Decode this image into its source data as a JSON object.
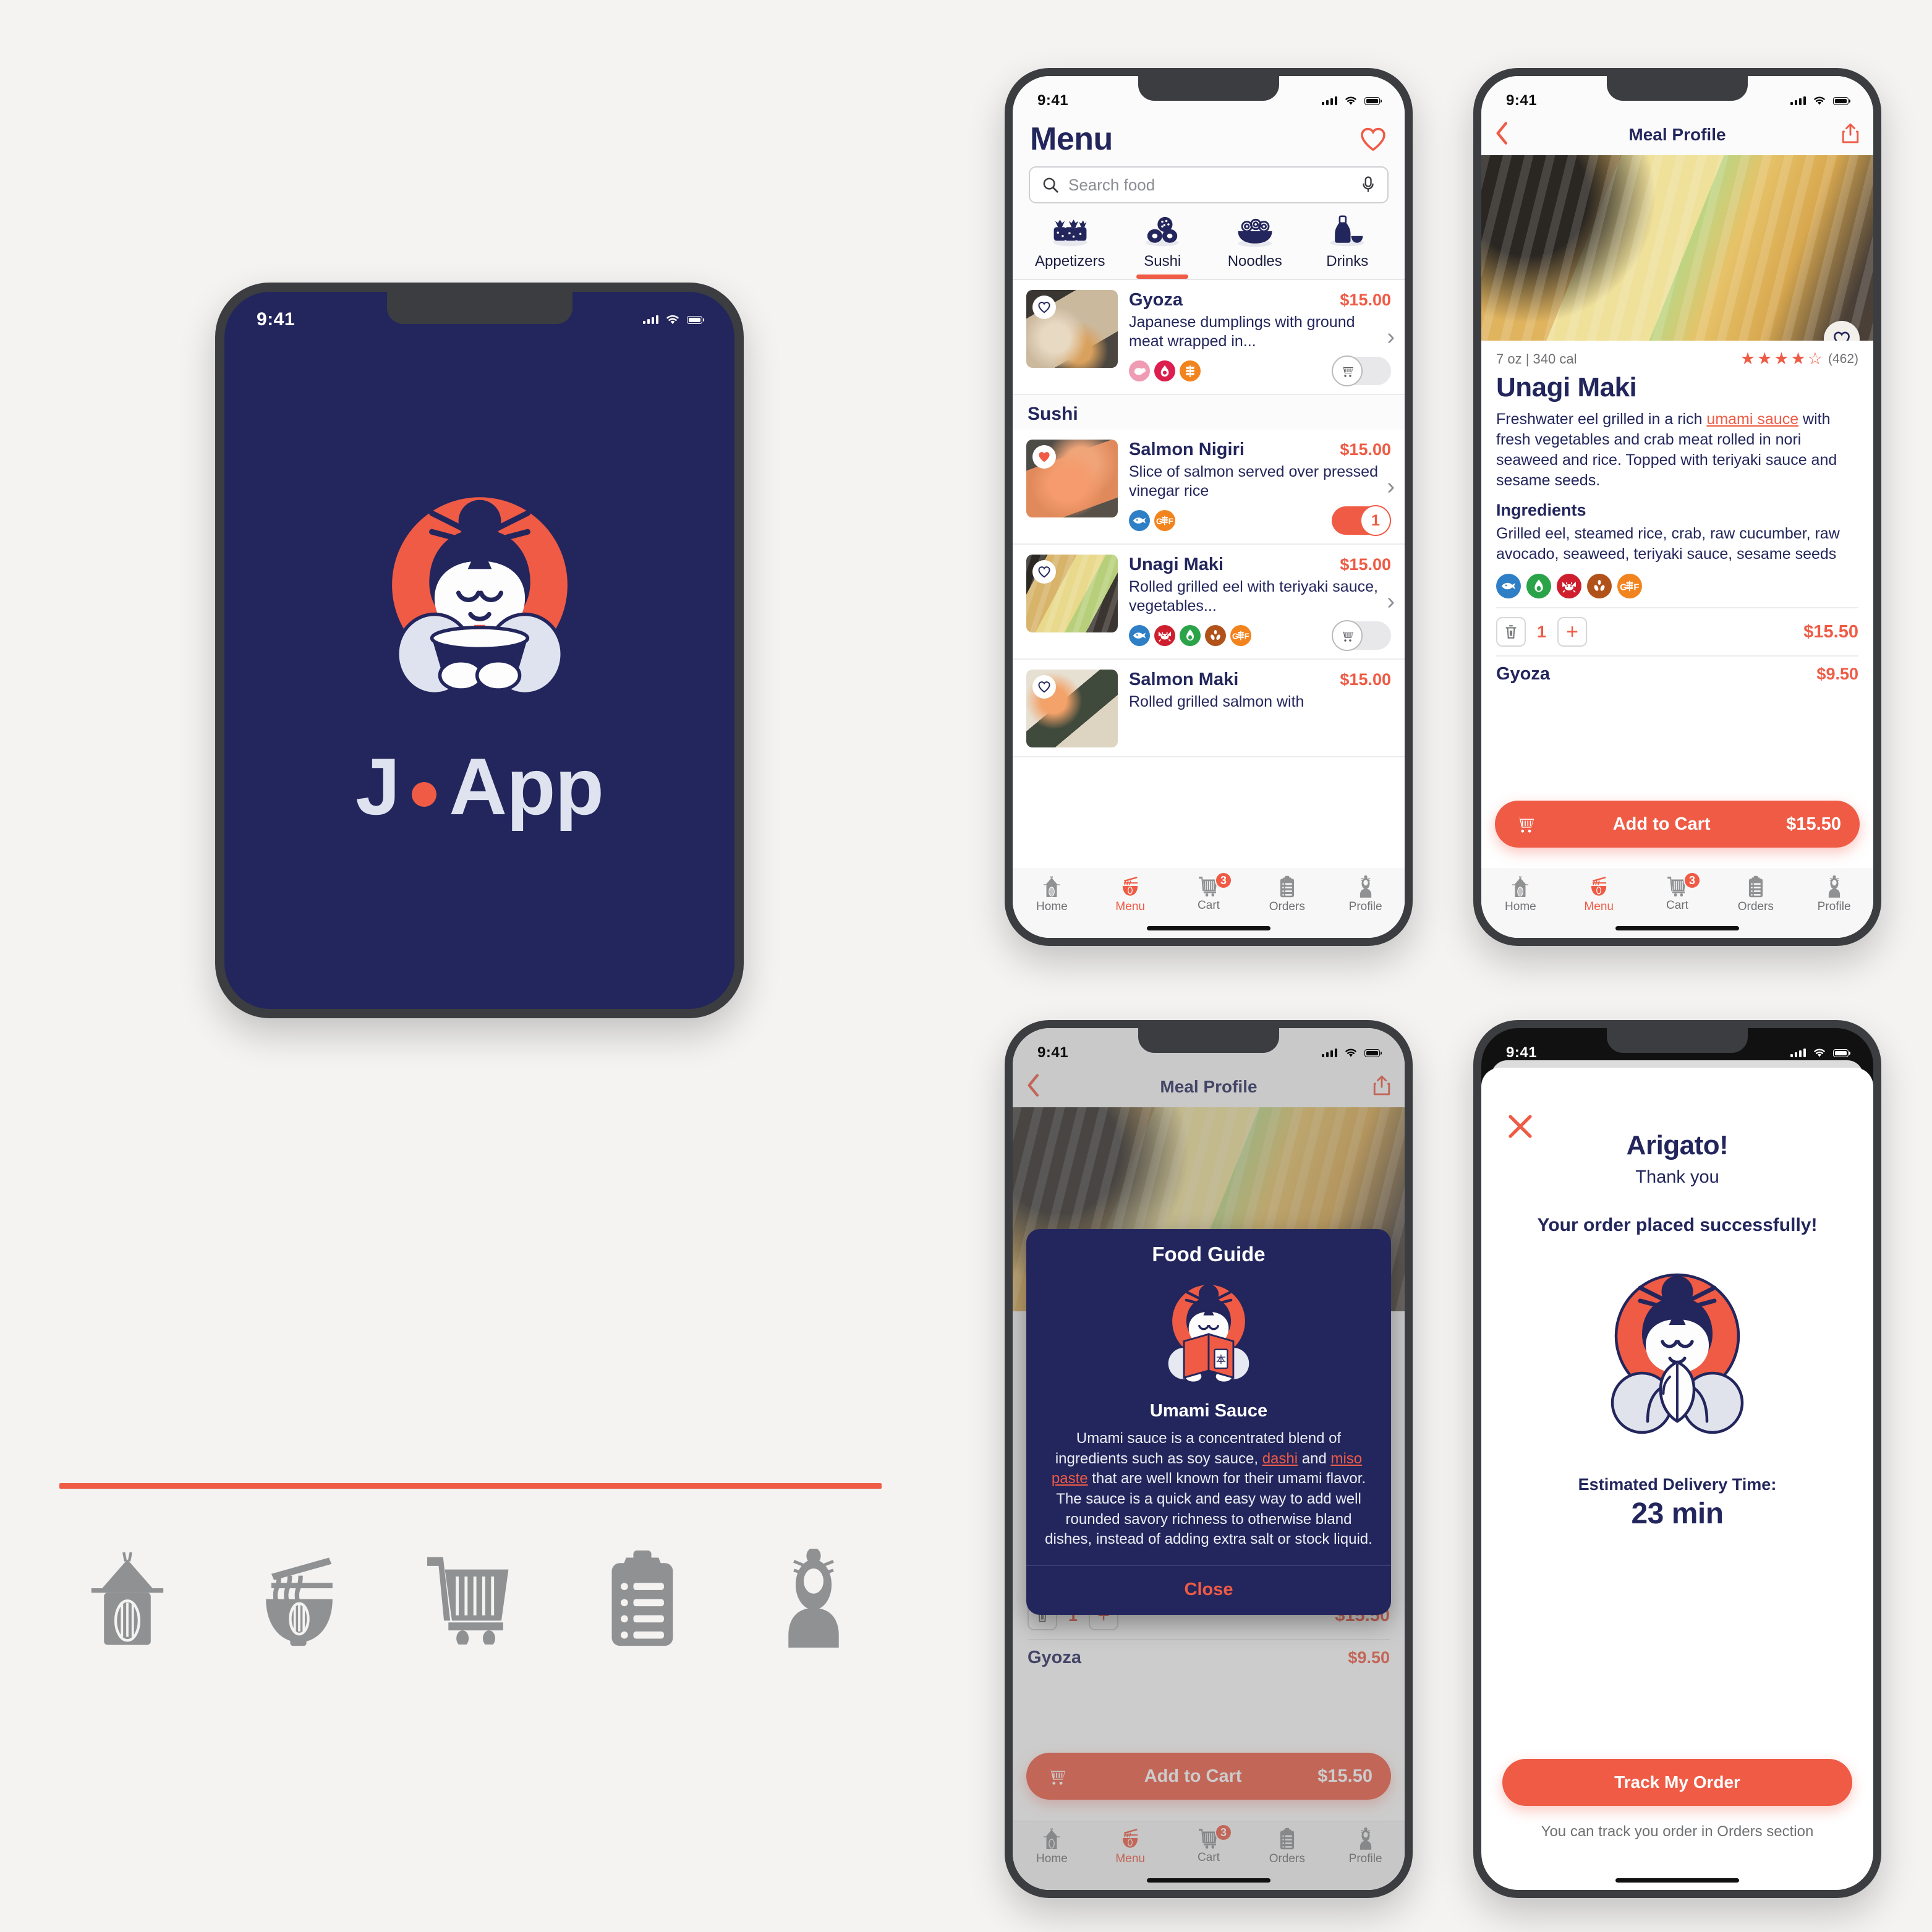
{
  "status_bar": {
    "time": "9:41"
  },
  "splash": {
    "brand_j": "J",
    "brand_app": "App"
  },
  "icon_strip": [
    {
      "name": "pagoda-icon"
    },
    {
      "name": "noodle-bowl-icon"
    },
    {
      "name": "shopping-cart-icon"
    },
    {
      "name": "clipboard-icon"
    },
    {
      "name": "profile-person-icon"
    }
  ],
  "tabbar": {
    "items": [
      {
        "label": "Home",
        "icon": "pagoda-icon",
        "badge": ""
      },
      {
        "label": "Menu",
        "icon": "noodle-bowl-icon",
        "badge": ""
      },
      {
        "label": "Cart",
        "icon": "shopping-cart-icon",
        "badge": "3"
      },
      {
        "label": "Orders",
        "icon": "clipboard-icon",
        "badge": ""
      },
      {
        "label": "Profile",
        "icon": "profile-person-icon",
        "badge": ""
      }
    ],
    "active": "Menu"
  },
  "menu_screen": {
    "title": "Menu",
    "favorites_icon": "heart-outline-icon",
    "search": {
      "placeholder": "Search food",
      "search_icon": "search-icon",
      "mic_icon": "microphone-icon"
    },
    "categories": [
      {
        "label": "Appetizers",
        "icon": "appetizers-icon",
        "active": false
      },
      {
        "label": "Sushi",
        "icon": "sushi-roll-icon",
        "active": true
      },
      {
        "label": "Noodles",
        "icon": "noodle-bowl-icon",
        "active": false
      },
      {
        "label": "Drinks",
        "icon": "sake-bottle-icon",
        "active": false
      }
    ],
    "section_header": "Sushi",
    "items": [
      {
        "name": "Gyoza",
        "price": "$15.00",
        "description": "Japanese dumplings with ground meat wrapped in...",
        "badges": [
          "pork",
          "spicy",
          "gluten"
        ],
        "favorited": false,
        "in_cart": false,
        "quantity": ""
      },
      {
        "name": "Salmon Nigiri",
        "price": "$15.00",
        "description": "Slice of salmon served over pressed vinegar rice",
        "badges": [
          "fish",
          "gluten-free"
        ],
        "favorited": true,
        "in_cart": true,
        "quantity": "1"
      },
      {
        "name": "Unagi Maki",
        "price": "$15.00",
        "description": "Rolled grilled eel with teriyaki sauce, vegetables...",
        "badges": [
          "fish",
          "crab",
          "avocado",
          "sesame",
          "gluten-free"
        ],
        "favorited": false,
        "in_cart": false,
        "quantity": ""
      },
      {
        "name": "Salmon Maki",
        "price": "$15.00",
        "description": "Rolled grilled salmon with",
        "badges": [],
        "favorited": false,
        "in_cart": false,
        "quantity": ""
      }
    ]
  },
  "meal_profile": {
    "nav_title": "Meal Profile",
    "back_icon": "chevron-left-icon",
    "share_icon": "share-icon",
    "favorite_icon": "heart-outline-icon",
    "serving": "7 oz | 340 cal",
    "rating_value": 4,
    "rating_count": "(462)",
    "title": "Unagi Maki",
    "description_pre": "Freshwater eel grilled in a rich ",
    "description_link": "umami sauce",
    "description_post": " with fresh vegetables and crab meat rolled in nori seaweed and rice. Topped with teriyaki sauce and sesame seeds.",
    "ingredients_label": "Ingredients",
    "ingredients": "Grilled eel, steamed rice, crab, raw cucumber, raw avocado, seaweed, teriyaki sauce, sesame seeds",
    "badges": [
      "fish",
      "avocado",
      "crab",
      "sesame",
      "gluten-free"
    ],
    "delete_icon": "trash-icon",
    "quantity": "1",
    "plus_label": "+",
    "line_total": "$15.50",
    "next_item_name": "Gyoza",
    "next_item_price": "$9.50",
    "cta": {
      "icon": "shopping-cart-icon",
      "label": "Add to Cart",
      "amount": "$15.50"
    }
  },
  "food_guide": {
    "title": "Food Guide",
    "mascot_icon": "mascot-reading-book-icon",
    "term": "Umami Sauce",
    "body_1": "Umami sauce is a concentrated blend of ingredients such as soy sauce, ",
    "link_1": "dashi",
    "body_2": " and ",
    "link_2": "miso paste",
    "body_3": " that are well known for their umami flavor. The sauce is a quick and easy way to add well rounded savory richness to otherwise bland dishes, instead of adding extra salt or stock liquid.",
    "close_label": "Close"
  },
  "order_success": {
    "close_icon": "close-x-icon",
    "title": "Arigato!",
    "subtitle": "Thank you",
    "message": "Your order placed successfully!",
    "mascot_icon": "mascot-praying-icon",
    "eta_label": "Estimated Delivery Time:",
    "eta_value": "23 min",
    "track_button": "Track My Order",
    "footnote": "You can track you order in Orders section"
  },
  "colors": {
    "brand_navy": "#23265c",
    "brand_coral": "#ef5b45",
    "page_bg": "#f4f3f2",
    "frame": "#3b3d40",
    "muted": "#8f9193"
  }
}
